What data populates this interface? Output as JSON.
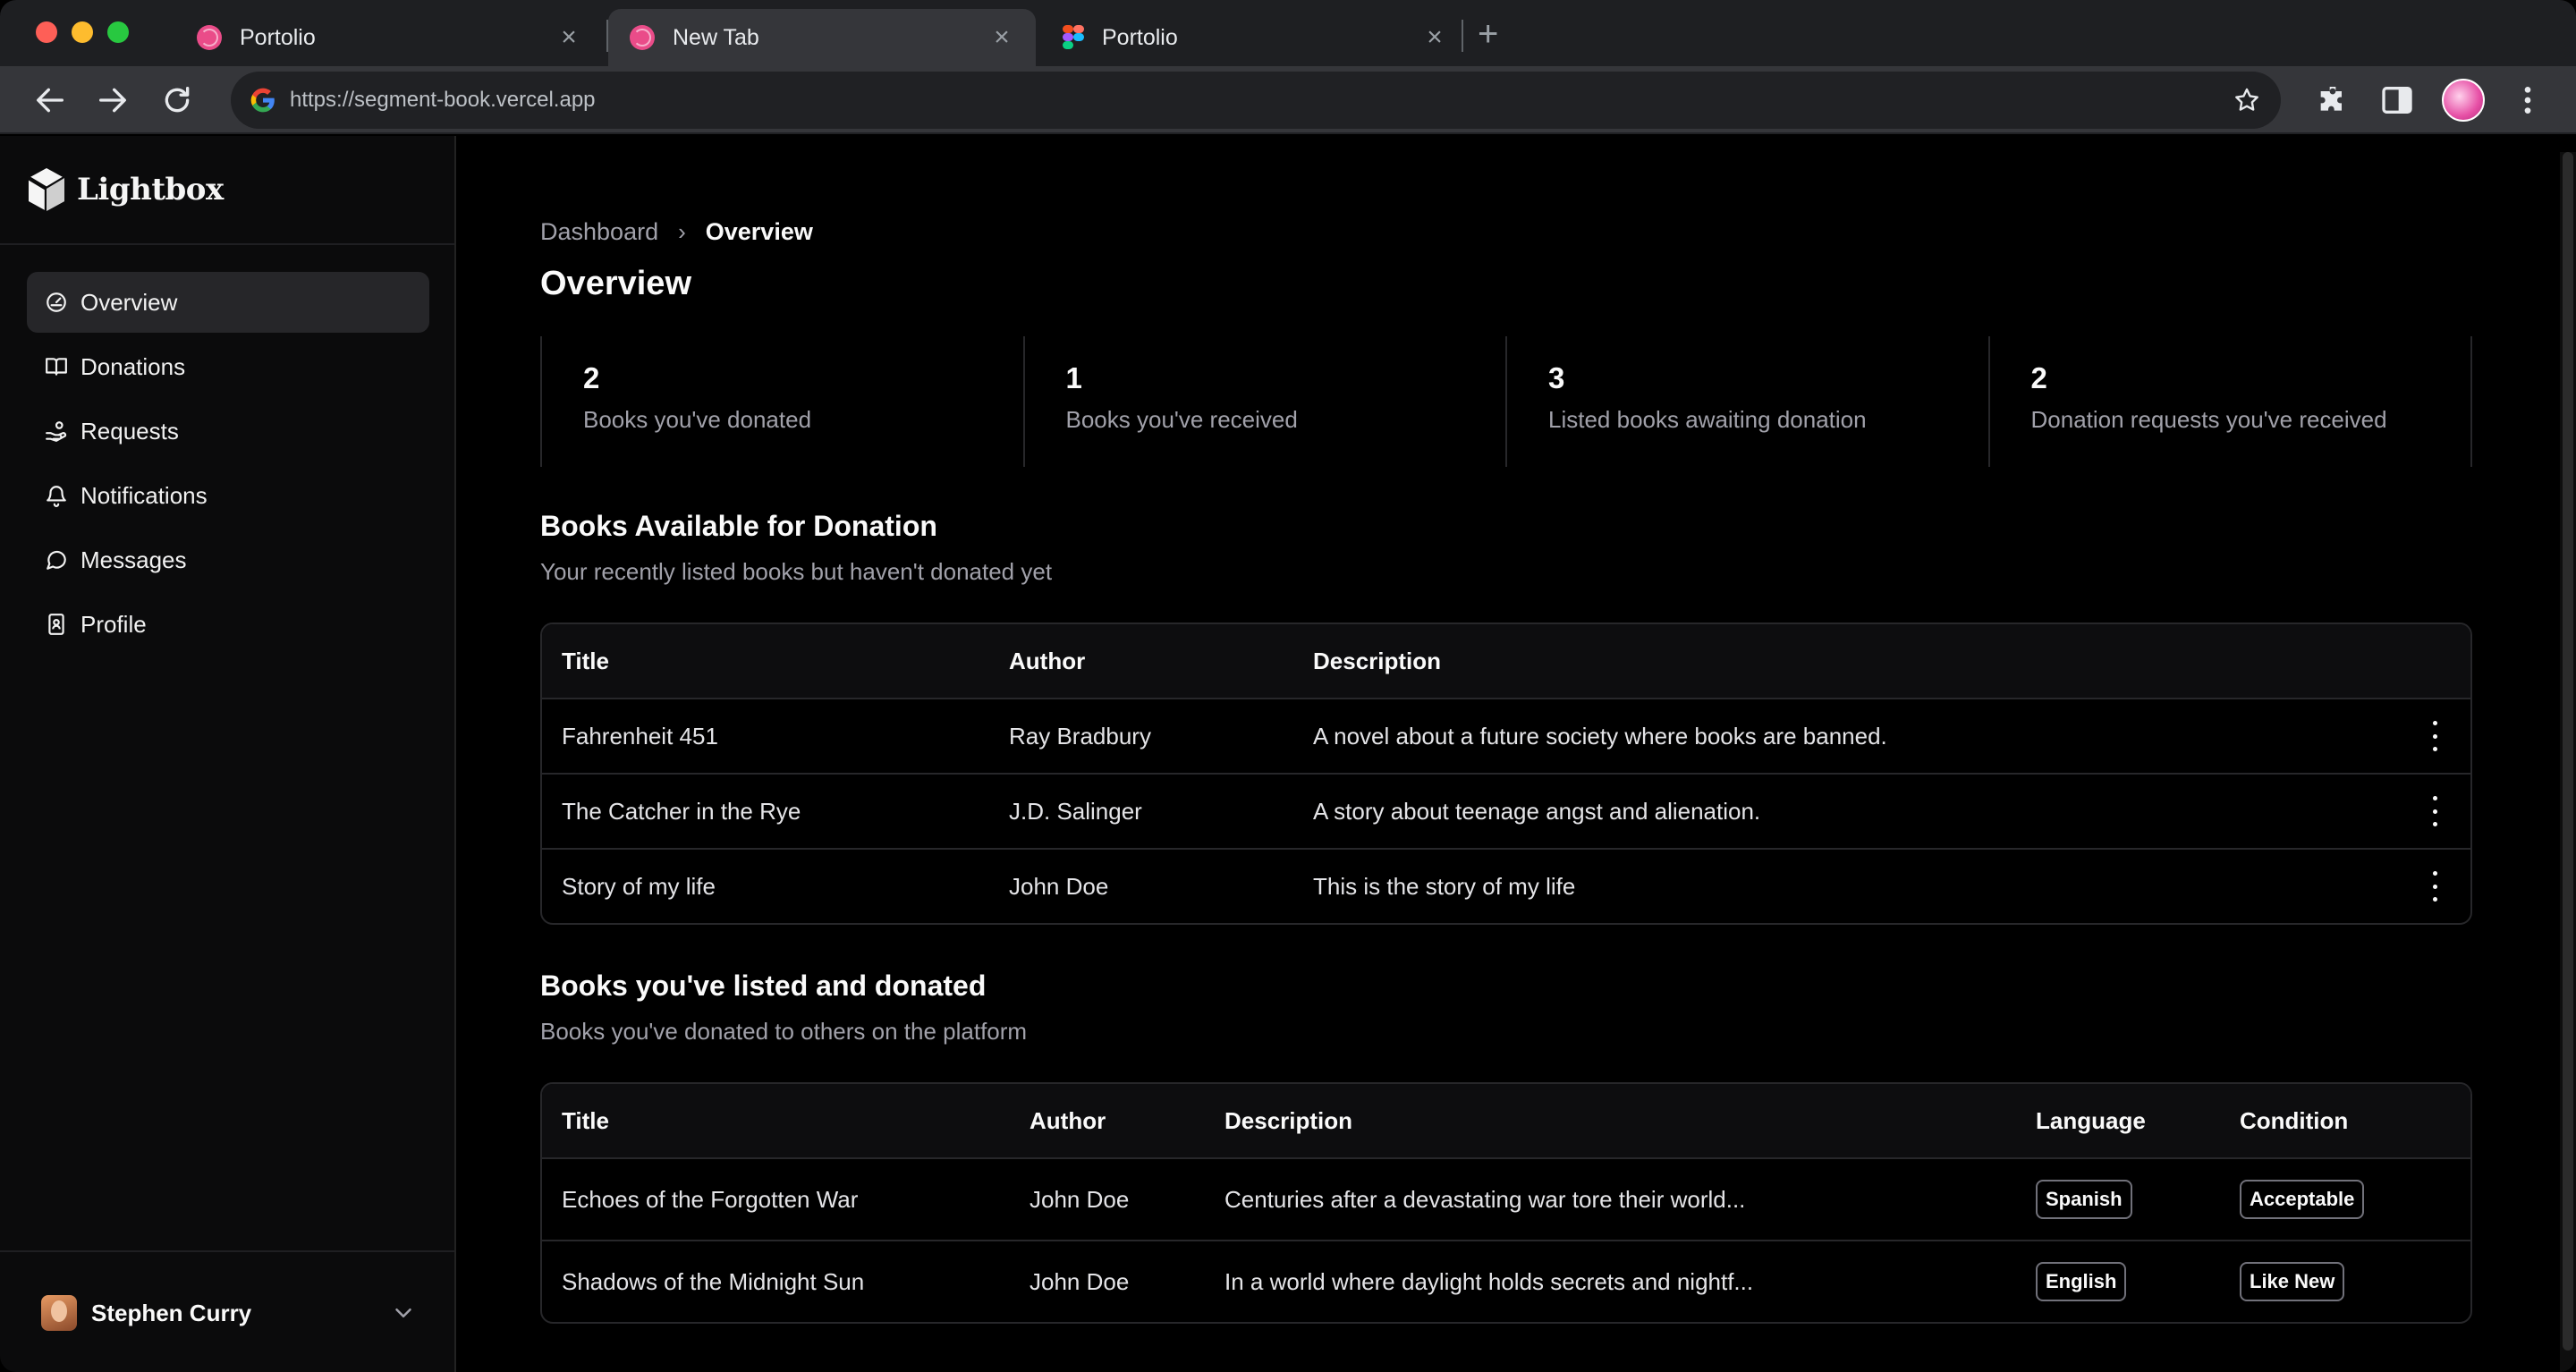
{
  "browser": {
    "tabs": [
      {
        "label": "Portolio",
        "favicon": "dribbble-icon"
      },
      {
        "label": "New Tab",
        "favicon": "dribbble-icon"
      },
      {
        "label": "Portolio",
        "favicon": "figma-icon"
      }
    ],
    "url": "https://segment-book.vercel.app"
  },
  "brand": {
    "name": "Lightbox"
  },
  "sidebar": {
    "items": [
      {
        "label": "Overview",
        "icon": "gauge-icon",
        "active": true
      },
      {
        "label": "Donations",
        "icon": "book-open-icon"
      },
      {
        "label": "Requests",
        "icon": "hand-coins-icon"
      },
      {
        "label": "Notifications",
        "icon": "bell-icon"
      },
      {
        "label": "Messages",
        "icon": "message-circle-icon"
      },
      {
        "label": "Profile",
        "icon": "contact-icon"
      }
    ],
    "user": {
      "name": "Stephen Curry"
    }
  },
  "breadcrumb": {
    "parent": "Dashboard",
    "separator": "›",
    "current": "Overview"
  },
  "page": {
    "title": "Overview"
  },
  "stats": [
    {
      "value": "2",
      "label": "Books you've donated"
    },
    {
      "value": "1",
      "label": "Books you've received"
    },
    {
      "value": "3",
      "label": "Listed books awaiting donation"
    },
    {
      "value": "2",
      "label": "Donation requests you've received"
    }
  ],
  "available": {
    "title": "Books Available for Donation",
    "subtitle": "Your recently listed books but haven't donated yet",
    "headers": {
      "title": "Title",
      "author": "Author",
      "description": "Description"
    },
    "rows": [
      {
        "title": "Fahrenheit 451",
        "author": "Ray Bradbury",
        "description": "A novel about a future society where books are banned."
      },
      {
        "title": "The Catcher in the Rye",
        "author": "J.D. Salinger",
        "description": "A story about teenage angst and alienation."
      },
      {
        "title": "Story of my life",
        "author": "John Doe",
        "description": "This is the story of my life"
      }
    ]
  },
  "donated": {
    "title": "Books you've listed and donated",
    "subtitle": "Books you've donated to others on the platform",
    "headers": {
      "title": "Title",
      "author": "Author",
      "description": "Description",
      "language": "Language",
      "condition": "Condition"
    },
    "rows": [
      {
        "title": "Echoes of the Forgotten War",
        "author": "John Doe",
        "description": "Centuries after a devastating war tore their world...",
        "language": "Spanish",
        "condition": "Acceptable"
      },
      {
        "title": "Shadows of the Midnight Sun",
        "author": "John Doe",
        "description": "In a world where daylight holds secrets and nightf...",
        "language": "English",
        "condition": "Like New"
      }
    ]
  },
  "colors": {
    "background": "#000000",
    "sidebar": "#0b0b0c",
    "border": "#27272a",
    "muted_text": "#a1a1aa",
    "active_nav": "#262629"
  }
}
